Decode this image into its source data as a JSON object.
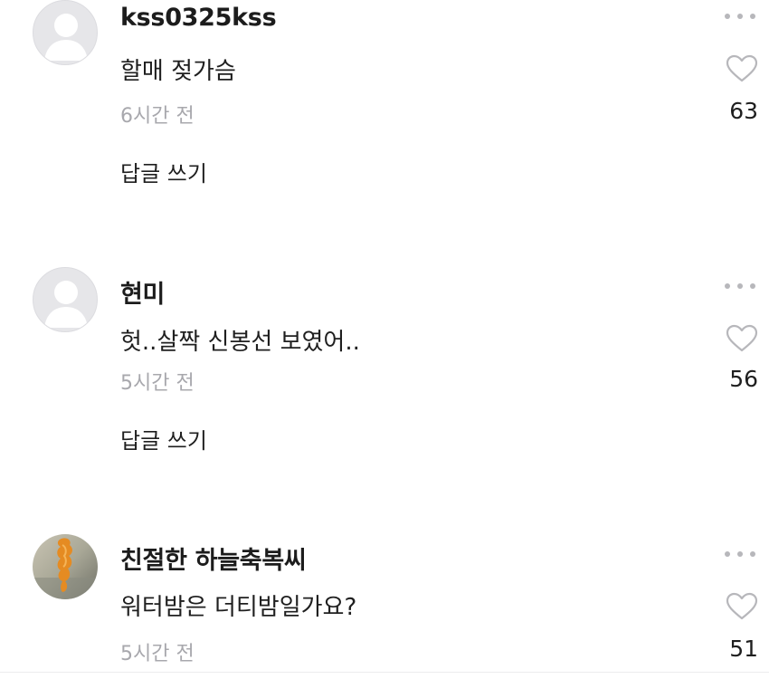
{
  "comments": [
    {
      "username": "kss0325kss",
      "text": "할매 젖가슴",
      "time": "6시간 전",
      "likes": "63",
      "reply_label": "답글 쓰기",
      "avatar": "default-avatar-icon"
    },
    {
      "username": "현미",
      "text": "헛..살짝 신봉선 보였어..",
      "time": "5시간 전",
      "likes": "56",
      "reply_label": "답글 쓰기",
      "avatar": "default-avatar-icon"
    },
    {
      "username": "친절한 하늘축복씨",
      "text": "워터밤은 더티밤일가요?",
      "time": "5시간 전",
      "likes": "51",
      "avatar": "photo-avatar"
    }
  ],
  "colors": {
    "text": "#1f1f1f",
    "muted": "#a8a8ad",
    "icon": "#b7b7bb",
    "avatar_bg": "#e6e6e9"
  },
  "icons": [
    "default-avatar-icon",
    "more-options-icon",
    "heart-icon"
  ]
}
